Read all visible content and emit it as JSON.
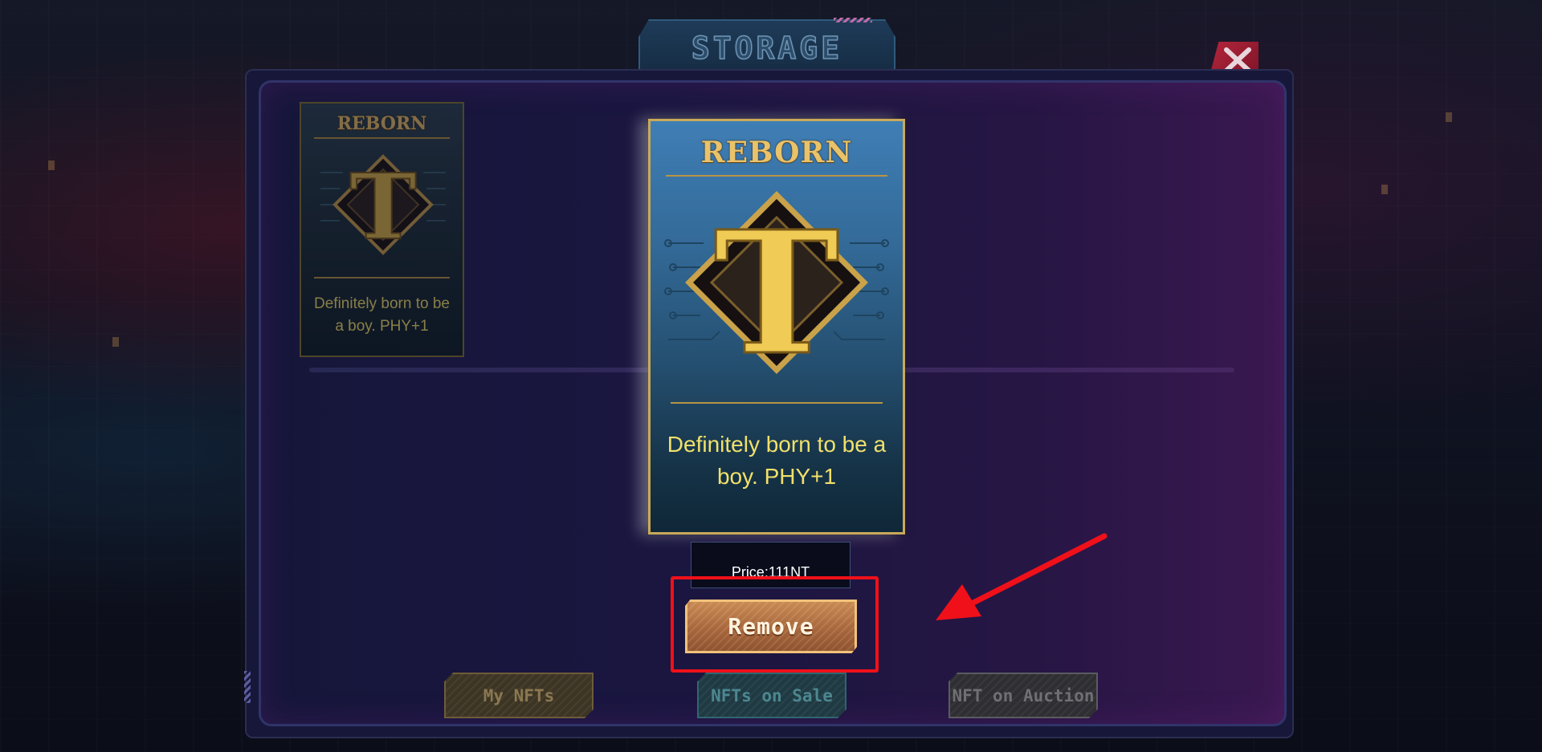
{
  "header": {
    "title": "STORAGE"
  },
  "window": {
    "close_icon": "close-x-icon"
  },
  "cards": {
    "small": {
      "logo": "REBORN",
      "emblem_letter": "T",
      "description": "Definitely born to be a boy. PHY+1"
    },
    "selected": {
      "logo": "REBORN",
      "emblem_letter": "T",
      "description": "Definitely born to be a boy. PHY+1"
    }
  },
  "price": {
    "text": "Price:111NT"
  },
  "actions": {
    "remove_label": "Remove"
  },
  "tabs": [
    {
      "label": "My NFTs"
    },
    {
      "label": "NFTs on Sale"
    },
    {
      "label": "NFT on Auction"
    }
  ],
  "annotation": {
    "highlight_color": "#f0101a",
    "arrow_color": "#f0101a"
  },
  "colors": {
    "gold": "#e9c26a",
    "card_text": "#f1e06a",
    "button": "#b07442"
  }
}
